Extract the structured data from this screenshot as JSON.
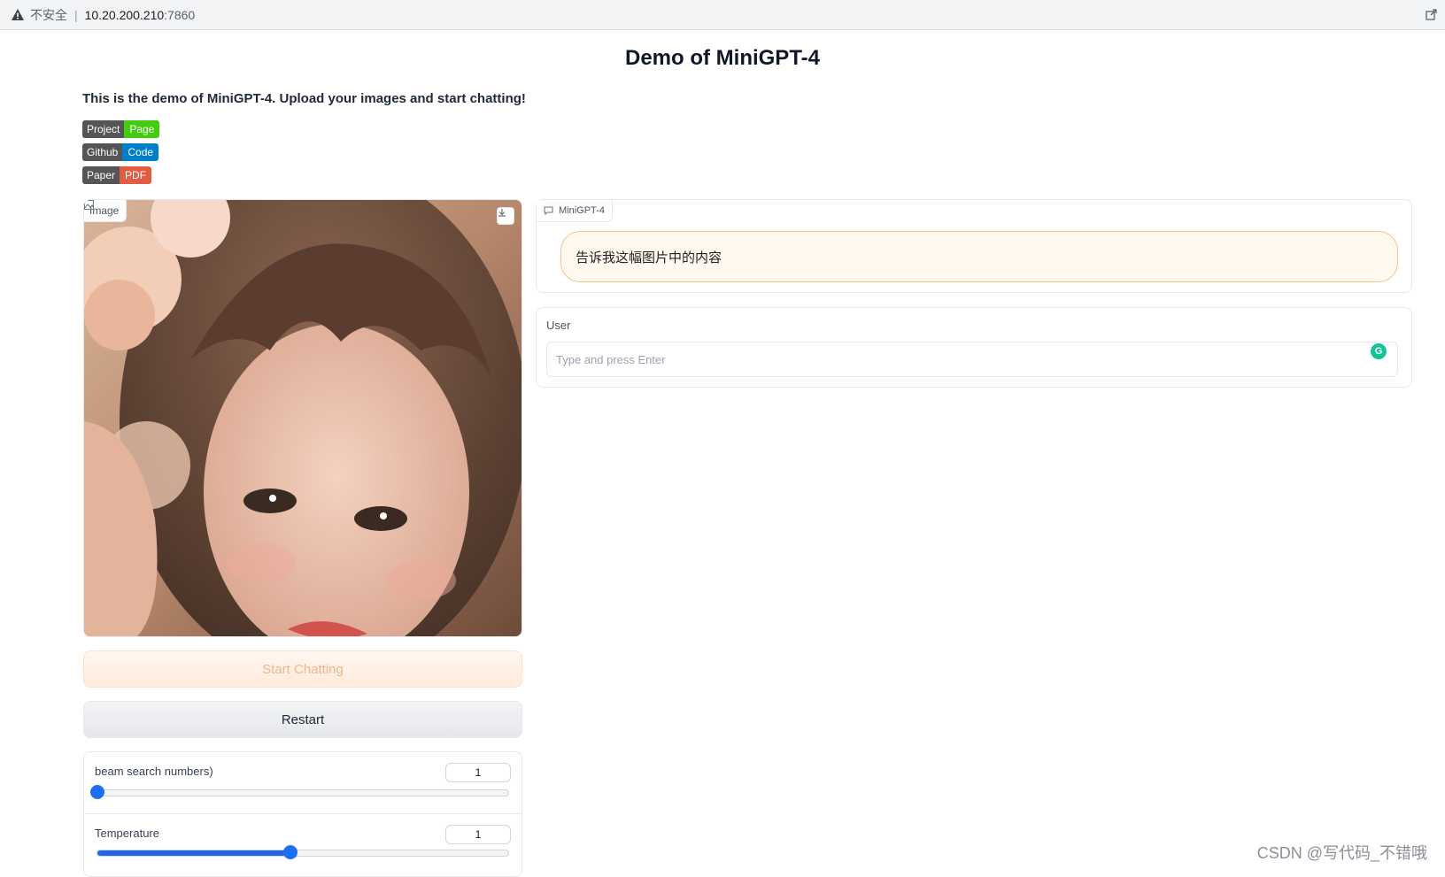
{
  "browser": {
    "insecure_label": "不安全",
    "host": "10.20.200.210",
    "port": ":7860"
  },
  "page": {
    "title": "Demo of MiniGPT-4",
    "description": "This is the demo of MiniGPT-4. Upload your images and start chatting!"
  },
  "badges": [
    {
      "left": "Project",
      "right": "Page",
      "color": "#4c1"
    },
    {
      "left": "Github",
      "right": "Code",
      "color": "#007ec6"
    },
    {
      "left": "Paper",
      "right": "PDF",
      "color": "#e05d44"
    }
  ],
  "image_panel": {
    "label": "Image",
    "label_icon": "image-icon",
    "download_icon": "download-icon"
  },
  "buttons": {
    "start": "Start Chatting",
    "restart": "Restart"
  },
  "sliders": [
    {
      "label": "beam search numbers)",
      "value": "1",
      "fraction": 0.0
    },
    {
      "label": "Temperature",
      "value": "1",
      "fraction": 0.47
    }
  ],
  "chatbot": {
    "label": "MiniGPT-4",
    "label_icon": "chat-icon",
    "messages": [
      "告诉我这幅图片中的内容"
    ]
  },
  "user_input": {
    "label": "User",
    "placeholder": "Type and press Enter",
    "value": ""
  },
  "watermark": "CSDN @写代码_不错哦",
  "colors": {
    "accent": "#2563eb",
    "bubble_border": "#f6c38f",
    "start_button_text": "#f0b48c"
  }
}
